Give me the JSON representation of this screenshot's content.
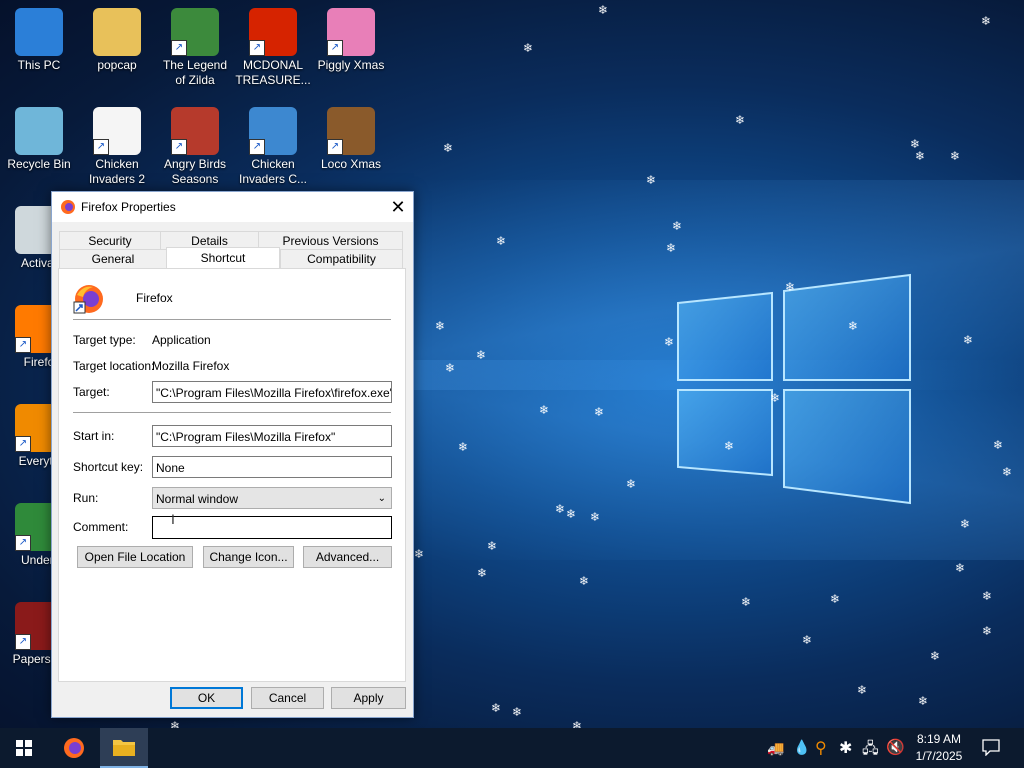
{
  "desktop": {
    "icons": [
      {
        "label": "This PC",
        "icon": "computer-icon",
        "color": "#2b7fd8"
      },
      {
        "label": "popcap",
        "icon": "folder-icon",
        "color": "#e8c15a"
      },
      {
        "label": "The Legend of Zilda",
        "icon": "game-icon",
        "color": "#3c8a3c"
      },
      {
        "label": "MCDONAL TREASURE...",
        "icon": "mcdonalds-icon",
        "color": "#d62300"
      },
      {
        "label": "Piggly Xmas",
        "icon": "pig-icon",
        "color": "#e87fb8"
      },
      {
        "label": "Recycle Bin",
        "icon": "recycle-bin-icon",
        "color": "#6fb6d9"
      },
      {
        "label": "Chicken Invaders 2",
        "icon": "chicken-icon",
        "color": "#f5f5f5"
      },
      {
        "label": "Angry Birds Seasons",
        "icon": "angry-bird-icon",
        "color": "#b63a2c"
      },
      {
        "label": "Chicken Invaders C...",
        "icon": "snowman-icon",
        "color": "#3d88d0"
      },
      {
        "label": "Loco Xmas",
        "icon": "bear-icon",
        "color": "#8a5a2b"
      },
      {
        "label": "Activat",
        "icon": "file-icon",
        "color": "#cfd8dc"
      },
      {
        "label": "Firefo",
        "icon": "firefox-icon",
        "color": "#ff7a00"
      },
      {
        "label": "Everyth",
        "icon": "search-icon",
        "color": "#f08a00"
      },
      {
        "label": "Undert",
        "icon": "undertale-icon",
        "color": "#2f8a3a"
      },
      {
        "label": "Papers, P",
        "icon": "papers-icon",
        "color": "#8a1a1a"
      }
    ]
  },
  "dialog": {
    "title": "Firefox Properties",
    "close_label": "✕",
    "tabs_top": [
      "Security",
      "Details",
      "Previous Versions"
    ],
    "tabs_bottom": [
      "General",
      "Shortcut",
      "Compatibility"
    ],
    "active_tab": "Shortcut",
    "app_name": "Firefox",
    "fields": {
      "target_type_label": "Target type:",
      "target_type_value": "Application",
      "target_location_label": "Target location:",
      "target_location_value": "Mozilla Firefox",
      "target_label": "Target:",
      "target_value": "\"C:\\Program Files\\Mozilla Firefox\\firefox.exe\"",
      "start_in_label": "Start in:",
      "start_in_value": "\"C:\\Program Files\\Mozilla Firefox\"",
      "shortcut_key_label": "Shortcut key:",
      "shortcut_key_value": "None",
      "run_label": "Run:",
      "run_value": "Normal window",
      "comment_label": "Comment:",
      "comment_value": ""
    },
    "buttons": {
      "open_file_location": "Open File Location",
      "change_icon": "Change Icon...",
      "advanced": "Advanced...",
      "ok": "OK",
      "cancel": "Cancel",
      "apply": "Apply"
    }
  },
  "taskbar": {
    "time": "8:19 AM",
    "date": "1/7/2025"
  }
}
